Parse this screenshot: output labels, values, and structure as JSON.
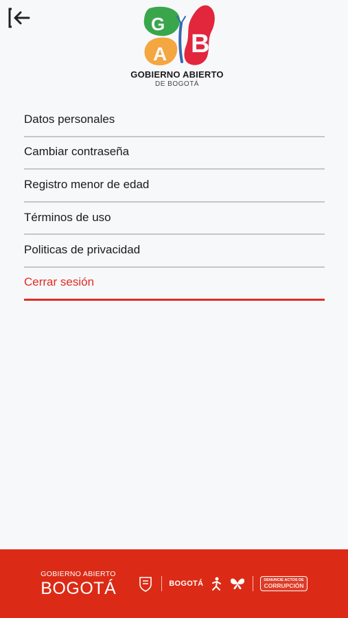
{
  "header": {
    "back_icon": "logout-arrow-left-icon",
    "logo": {
      "title": "GOBIERNO ABIERTO",
      "subtitle": "DE BOGOTÁ",
      "colors": {
        "green": "#3aa64b",
        "orange": "#f4a640",
        "red": "#e2263b",
        "blue": "#3567b3"
      }
    }
  },
  "menu": {
    "items": [
      {
        "label": "Datos personales"
      },
      {
        "label": "Cambiar contraseña"
      },
      {
        "label": "Registro menor de edad"
      },
      {
        "label": "Términos de uso"
      },
      {
        "label": "Politicas de privacidad"
      }
    ],
    "logout_label": "Cerrar sesión"
  },
  "footer": {
    "brand_small": "GOBIERNO ABIERTO",
    "brand_big": "BOGOTÁ",
    "bogota_mark": "BOGOTÁ",
    "denuncie_line1": "DENUNCIE ACTOS DE",
    "denuncie_line2": "CORRUPCIÓN",
    "background": "#db2b16"
  },
  "colors": {
    "background": "#f7f8fa",
    "accent_red": "#e22b20",
    "divider": "#c6c6c8"
  }
}
